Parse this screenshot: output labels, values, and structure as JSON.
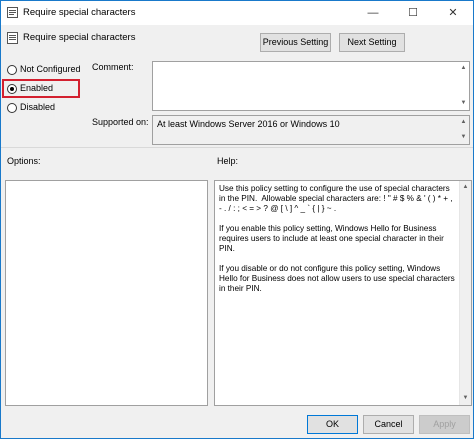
{
  "window": {
    "title": "Require special characters"
  },
  "header": {
    "title": "Require special characters",
    "prev_label": "Previous Setting",
    "next_label": "Next Setting"
  },
  "state": {
    "options": [
      {
        "label": "Not Configured",
        "selected": false
      },
      {
        "label": "Enabled",
        "selected": true
      },
      {
        "label": "Disabled",
        "selected": false
      }
    ]
  },
  "comment": {
    "label": "Comment:",
    "value": ""
  },
  "supported": {
    "label": "Supported on:",
    "value": "At least Windows Server 2016 or Windows 10"
  },
  "options_pane": {
    "label": "Options:"
  },
  "help_pane": {
    "label": "Help:",
    "text": "Use this policy setting to configure the use of special characters\nin the PIN.  Allowable special characters are: ! \" # $ % & ' ( ) * + ,\n- . / : ; < = > ? @ [ \\ ] ^ _ ` { | } ~ .\n\nIf you enable this policy setting, Windows Hello for Business\nrequires users to include at least one special character in their\nPIN.\n\nIf you disable or do not configure this policy setting, Windows\nHello for Business does not allow users to use special characters\nin their PIN."
  },
  "footer": {
    "ok_label": "OK",
    "cancel_label": "Cancel",
    "apply_label": "Apply"
  },
  "colors": {
    "highlight": "#d3202f",
    "title_border": "#1979ca"
  }
}
